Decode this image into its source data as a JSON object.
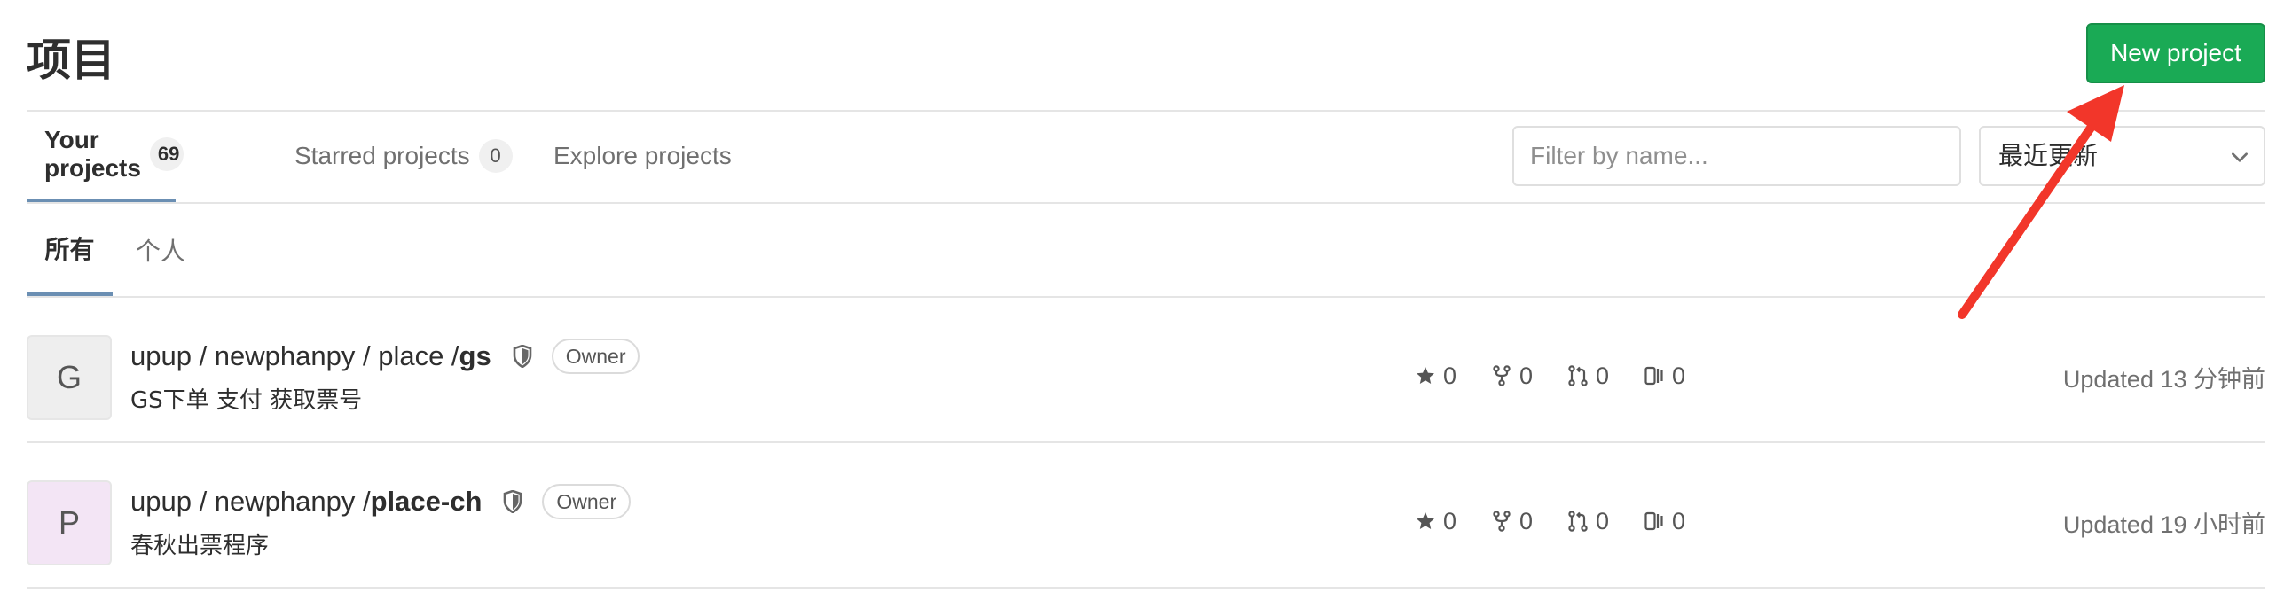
{
  "header": {
    "title": "项目",
    "new_project_label": "New project"
  },
  "tabs": [
    {
      "label": "Your projects",
      "count": "69",
      "active": true
    },
    {
      "label": "Starred projects",
      "count": "0",
      "active": false
    },
    {
      "label": "Explore projects",
      "active": false
    }
  ],
  "filter": {
    "placeholder": "Filter by name...",
    "value": ""
  },
  "sort": {
    "selected": "最近更新"
  },
  "subtabs": [
    {
      "label": "所有",
      "active": true
    },
    {
      "label": "个人",
      "active": false
    }
  ],
  "projects": [
    {
      "avatar_letter": "G",
      "avatar_color": "#eeeeee",
      "namespace": "upup / newphanpy / place / ",
      "name": "gs",
      "role": "Owner",
      "description": "GS下单 支付 获取票号",
      "stars": "0",
      "forks": "0",
      "merge_requests": "0",
      "issues": "0",
      "updated": "Updated 13 分钟前"
    },
    {
      "avatar_letter": "P",
      "avatar_color": "#f3e5f5",
      "namespace": "upup / newphanpy / ",
      "name": "place-ch",
      "role": "Owner",
      "description": "春秋出票程序",
      "stars": "0",
      "forks": "0",
      "merge_requests": "0",
      "issues": "0",
      "updated": "Updated 19 小时前"
    }
  ],
  "icons": {
    "star": "star-icon",
    "fork": "fork-icon",
    "merge_request": "merge-request-icon",
    "issues": "issues-icon",
    "visibility": "shield-icon",
    "sort": "chevron-down-icon"
  },
  "colors": {
    "primary_button": "#1aaa55",
    "active_tab_underline": "#6b8fb3",
    "annotation_arrow": "#f2362a"
  }
}
